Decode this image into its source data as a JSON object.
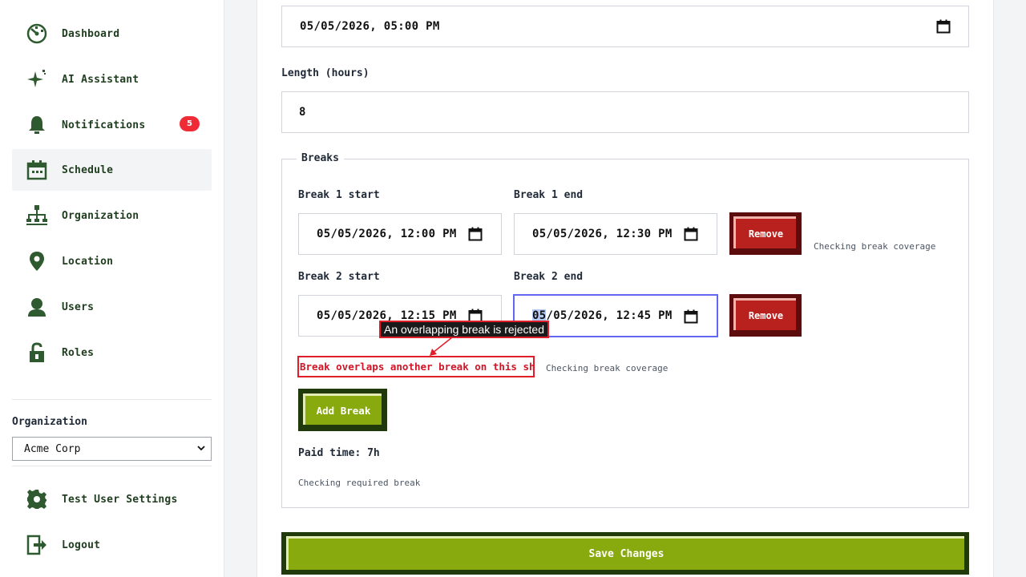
{
  "sidebar": {
    "items": [
      {
        "label": "Dashboard",
        "icon": "dashboard-icon"
      },
      {
        "label": "AI Assistant",
        "icon": "sparkle-icon"
      },
      {
        "label": "Notifications",
        "icon": "bell-icon",
        "badge": "5"
      },
      {
        "label": "Schedule",
        "icon": "calendar-icon",
        "active": true
      },
      {
        "label": "Organization",
        "icon": "org-chart-icon"
      },
      {
        "label": "Location",
        "icon": "map-pin-icon"
      },
      {
        "label": "Users",
        "icon": "user-icon"
      },
      {
        "label": "Roles",
        "icon": "lock-icon"
      }
    ],
    "organization_label": "Organization",
    "organization_value": "Acme Corp",
    "footer": [
      {
        "label": "Test User Settings",
        "icon": "gear-icon"
      },
      {
        "label": "Logout",
        "icon": "logout-icon"
      }
    ]
  },
  "form": {
    "start_value": "05/05/2026, 05:00 PM",
    "length_label": "Length (hours)",
    "length_value": "8",
    "breaks_legend": "Breaks",
    "breaks": [
      {
        "start_label": "Break 1 start",
        "start_value": "05/05/2026, 12:00 PM",
        "end_label": "Break 1 end",
        "end_value": "05/05/2026, 12:30 PM",
        "remove_label": "Remove",
        "hint": "Checking break coverage"
      },
      {
        "start_label": "Break 2 start",
        "start_value": "05/05/2026, 12:15 PM",
        "end_label": "Break 2 end",
        "end_value": "05/05/2026, 12:45 PM",
        "end_value_selected": "05",
        "end_value_rest": "/05/2026, 12:45 PM",
        "remove_label": "Remove",
        "hint": "Checking break coverage"
      }
    ],
    "error": "Break overlaps another break on this shift",
    "tooltip": "An overlapping break is rejected",
    "add_break_label": "Add Break",
    "paid_time": "Paid time: 7h",
    "required_hint": "Checking required break",
    "save_label": "Save Changes"
  },
  "colors": {
    "brand_green": "#89aa0e",
    "danger_red": "#b8211e",
    "badge_red": "#ef2b36",
    "focus": "#6366f1"
  }
}
